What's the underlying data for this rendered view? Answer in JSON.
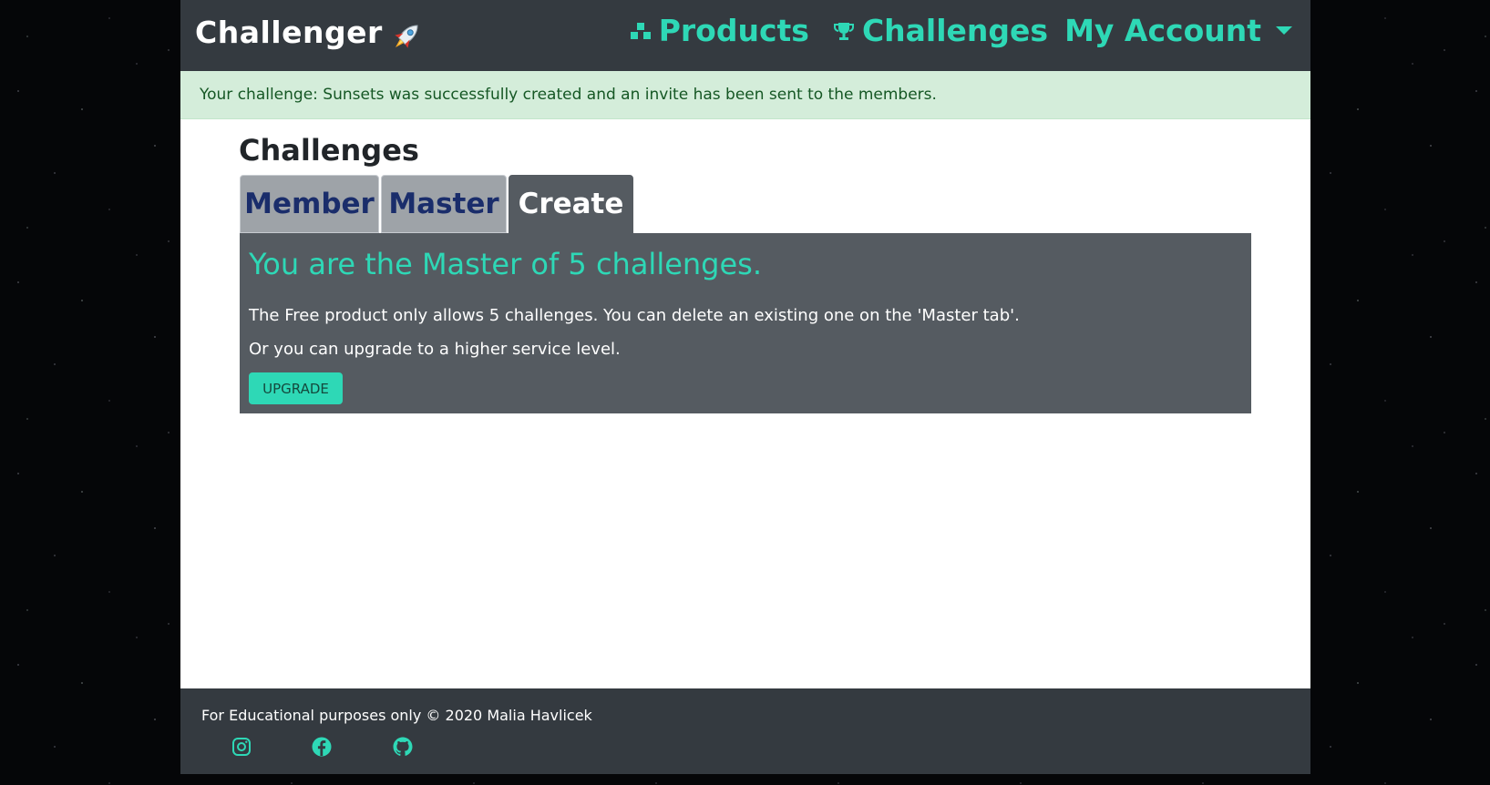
{
  "brand": {
    "name": "Challenger"
  },
  "nav": {
    "products": "Products",
    "challenges": "Challenges",
    "account": "My Account"
  },
  "alert": {
    "message": "Your challenge: Sunsets was successfully created and an invite has been sent to the members."
  },
  "main": {
    "heading": "Challenges",
    "tabs": [
      {
        "label": "Member"
      },
      {
        "label": "Master"
      },
      {
        "label": "Create"
      }
    ],
    "active_tab": "Create",
    "panel": {
      "title": "You are the Master of 5 challenges.",
      "line1": "The Free product only allows 5 challenges. You can delete an existing one on the 'Master tab'.",
      "line2": "Or you can upgrade to a higher service level.",
      "button": "UPGRADE"
    }
  },
  "footer": {
    "text": "For Educational purposes only © 2020 Malia Havlicek",
    "icons": [
      "instagram-icon",
      "facebook-icon",
      "github-icon"
    ]
  },
  "colors": {
    "accent": "#2ed8b6",
    "navbar": "#343a40",
    "panel": "#555b61",
    "alert_bg": "#d4edda",
    "tab_text": "#1a2d6b"
  }
}
